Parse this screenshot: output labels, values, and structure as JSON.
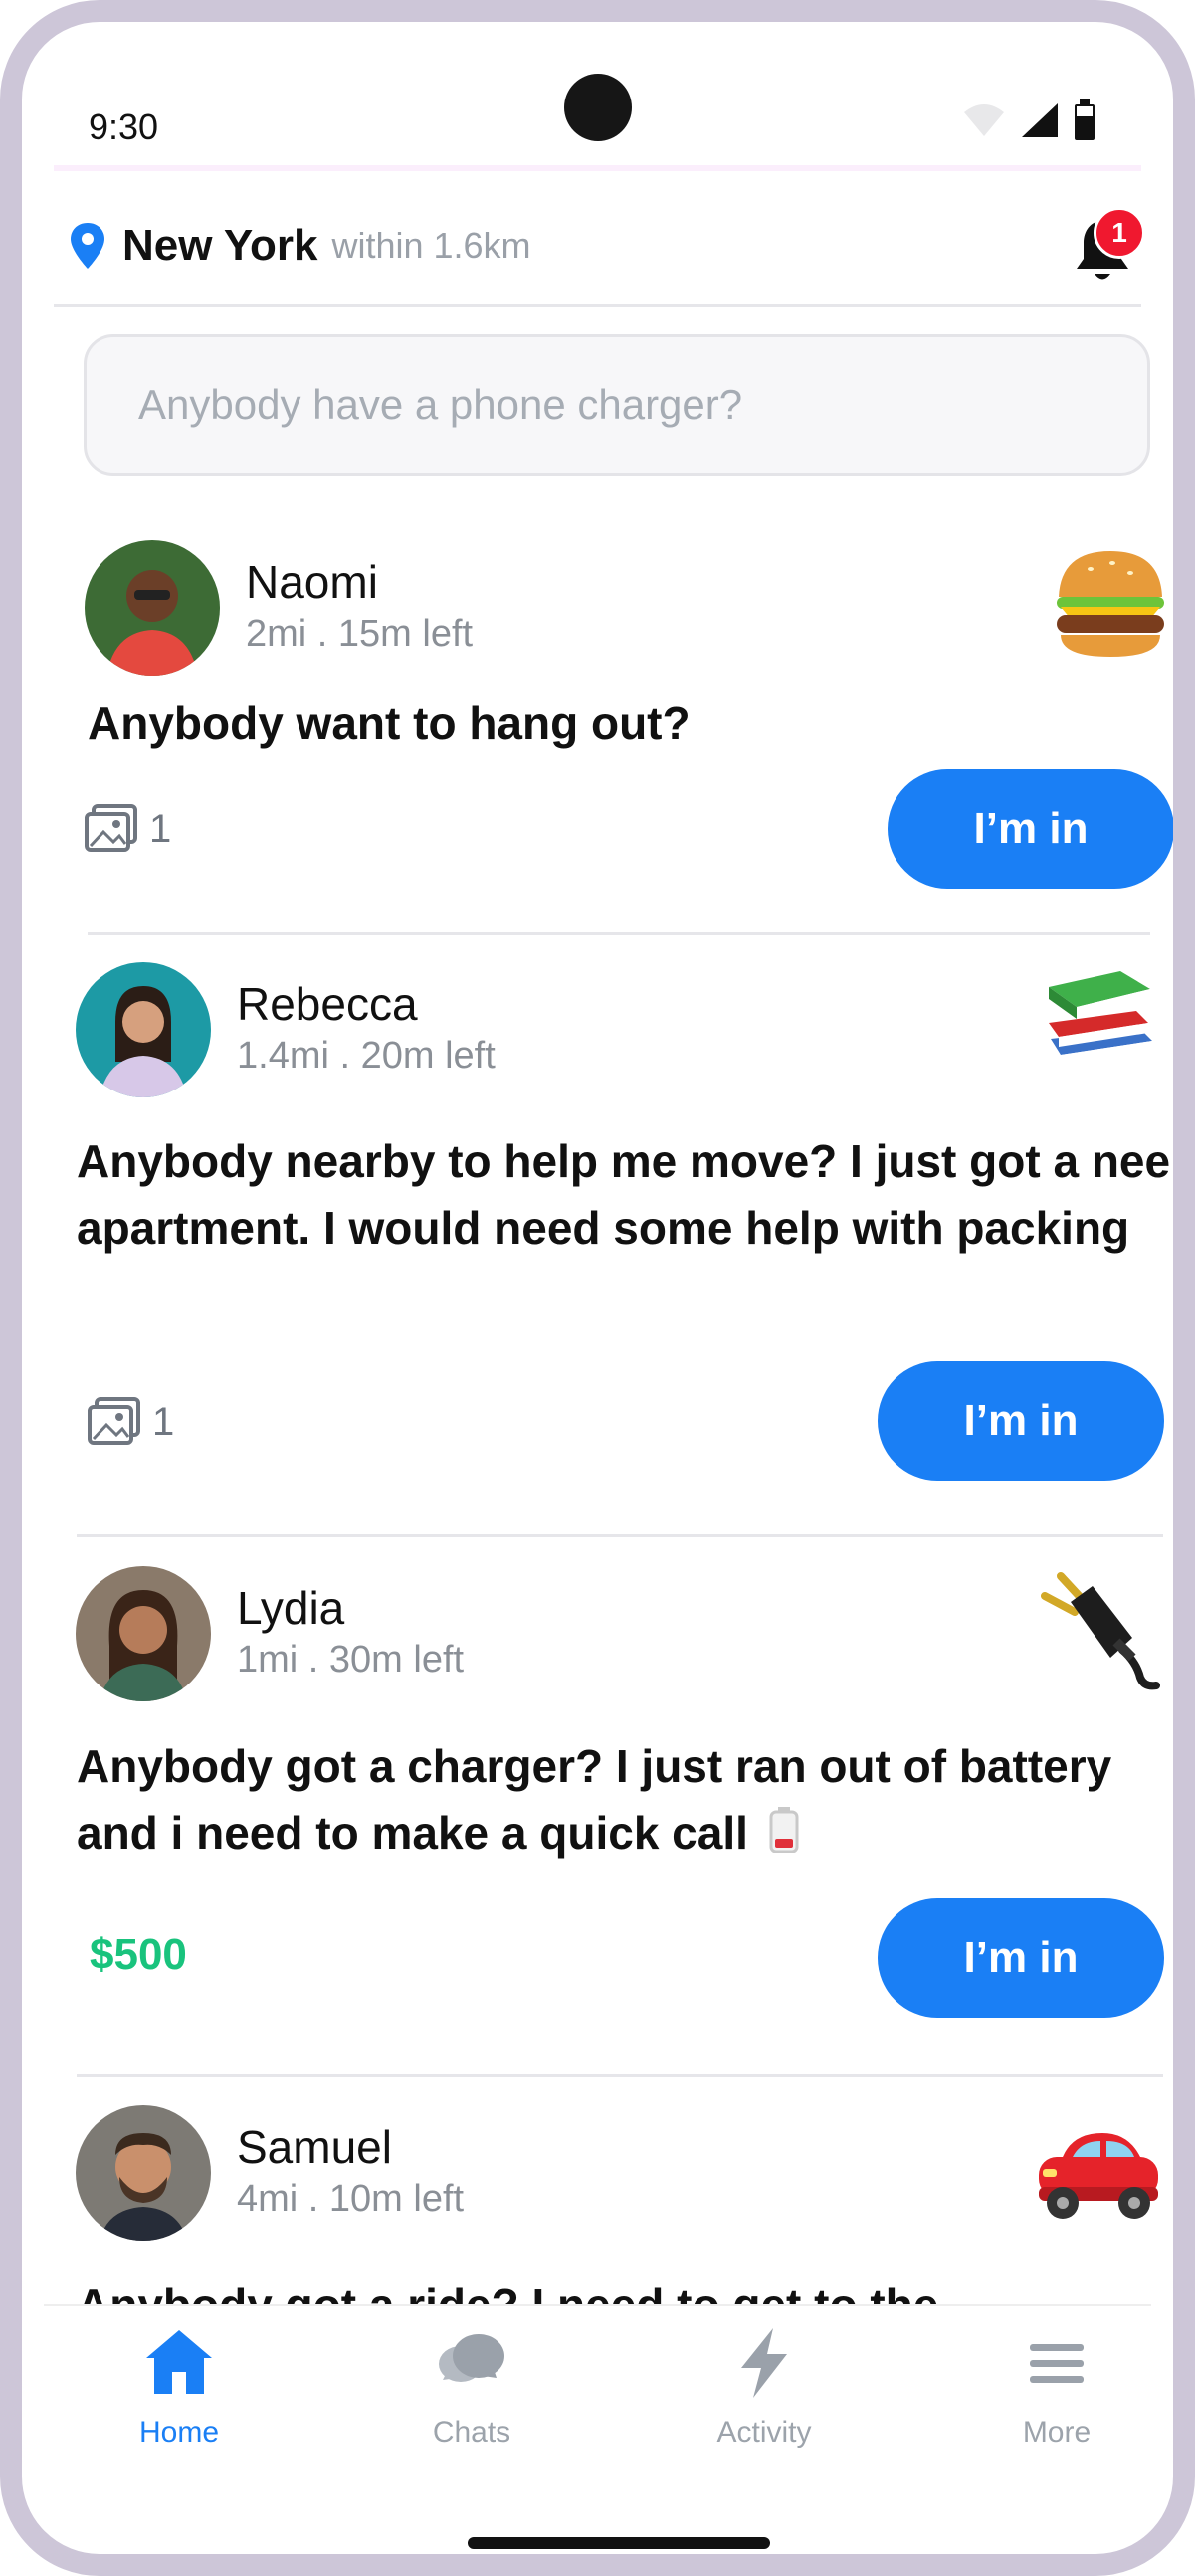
{
  "status_bar": {
    "time": "9:30"
  },
  "header": {
    "city": "New York",
    "radius": "within 1.6km",
    "notification_count": "1"
  },
  "search": {
    "placeholder": "Anybody have a phone charger?"
  },
  "posts": [
    {
      "name": "Naomi",
      "meta": "2mi . 15m left",
      "emoji_icon": "burger-icon",
      "text": "Anybody want to hang out?",
      "attachment_count": "1",
      "reward": null,
      "action_label": "I’m in"
    },
    {
      "name": "Rebecca",
      "meta": "1.4mi . 20m left",
      "emoji_icon": "books-icon",
      "text": "Anybody nearby to help me move?  I just got a nee apartment. I would need some help with packing",
      "attachment_count": "1",
      "reward": null,
      "action_label": "I’m in"
    },
    {
      "name": "Lydia",
      "meta": "1mi . 30m left",
      "emoji_icon": "electric-plug-icon",
      "text": "Anybody got a charger? I just ran out of battery and i need to make a quick call",
      "attachment_count": null,
      "reward": "$500",
      "action_label": "I’m in"
    },
    {
      "name": "Samuel",
      "meta": "4mi . 10m left",
      "emoji_icon": "car-icon",
      "text": "Anybody got a ride? I need to get  to the",
      "attachment_count": null,
      "reward": null,
      "action_label": null
    }
  ],
  "nav": [
    {
      "label": "Home",
      "icon": "home-icon",
      "active": true
    },
    {
      "label": "Chats",
      "icon": "chat-icon",
      "active": false
    },
    {
      "label": "Activity",
      "icon": "lightning-icon",
      "active": false
    },
    {
      "label": "More",
      "icon": "menu-icon",
      "active": false
    }
  ],
  "colors": {
    "accent": "#1a7ff5",
    "reward": "#19c37d",
    "badge": "#f0182f"
  }
}
